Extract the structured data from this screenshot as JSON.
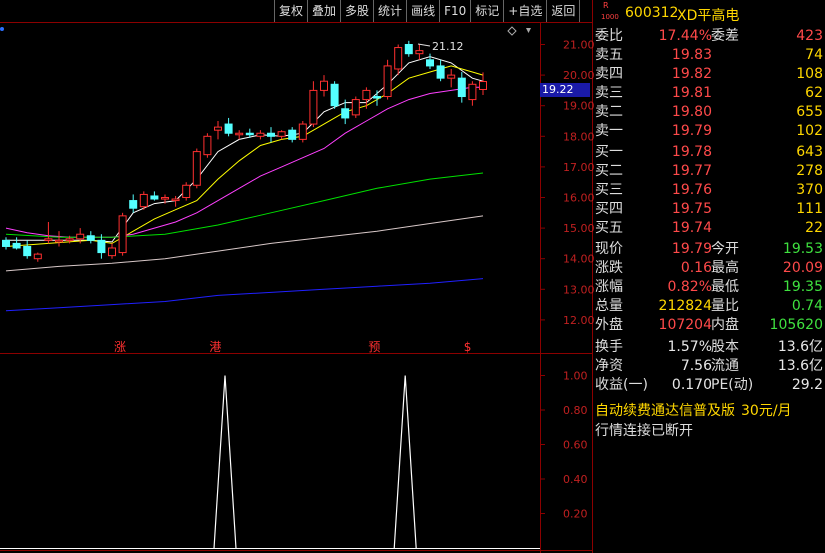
{
  "toolbar": [
    "复权",
    "叠加",
    "多股",
    "统计",
    "画线",
    "F10",
    "标记",
    "+自选",
    "返回"
  ],
  "stock": {
    "r_mark": "R",
    "lot": "1000",
    "code": "600312",
    "name": "XD平高电"
  },
  "quote_rows": [
    {
      "label": "委比",
      "value": "17.44%",
      "label2": "委差",
      "value2": "423",
      "c1": "red",
      "c2": "red"
    },
    {
      "label": "卖五",
      "value": "19.83",
      "value2": "74",
      "c1": "red",
      "c2": "yel"
    },
    {
      "label": "卖四",
      "value": "19.82",
      "value2": "108",
      "c1": "red",
      "c2": "yel"
    },
    {
      "label": "卖三",
      "value": "19.81",
      "value2": "62",
      "c1": "red",
      "c2": "yel"
    },
    {
      "label": "卖二",
      "value": "19.80",
      "value2": "655",
      "c1": "red",
      "c2": "yel"
    },
    {
      "label": "卖一",
      "value": "19.79",
      "value2": "102",
      "c1": "red",
      "c2": "yel"
    },
    {
      "label": "买一",
      "value": "19.78",
      "value2": "643",
      "c1": "red",
      "c2": "yel"
    },
    {
      "label": "买二",
      "value": "19.77",
      "value2": "278",
      "c1": "red",
      "c2": "yel"
    },
    {
      "label": "买三",
      "value": "19.76",
      "value2": "370",
      "c1": "red",
      "c2": "yel"
    },
    {
      "label": "买四",
      "value": "19.75",
      "value2": "111",
      "c1": "red",
      "c2": "yel"
    },
    {
      "label": "买五",
      "value": "19.74",
      "value2": "22",
      "c1": "red",
      "c2": "yel"
    },
    {
      "label": "现价",
      "value": "19.79",
      "label2": "今开",
      "value2": "19.53",
      "c1": "red",
      "c2": "grn"
    },
    {
      "label": "涨跌",
      "value": "0.16",
      "label2": "最高",
      "value2": "20.09",
      "c1": "red",
      "c2": "red"
    },
    {
      "label": "涨幅",
      "value": "0.82%",
      "label2": "最低",
      "value2": "19.35",
      "c1": "red",
      "c2": "grn"
    },
    {
      "label": "总量",
      "value": "212824",
      "label2": "量比",
      "value2": "0.74",
      "c1": "yel",
      "c2": "grn"
    },
    {
      "label": "外盘",
      "value": "107204",
      "label2": "内盘",
      "value2": "105620",
      "c1": "red",
      "c2": "grn"
    },
    {
      "label": "换手",
      "value": "1.57%",
      "label2": "股本",
      "value2": "13.6亿",
      "c1": "wht",
      "c2": "wht"
    },
    {
      "label": "净资",
      "value": "7.56",
      "label2": "流通",
      "value2": "13.6亿",
      "c1": "wht",
      "c2": "wht"
    },
    {
      "label": "收益(一)",
      "value": "0.170",
      "label2": "PE(动)",
      "value2": "29.2",
      "c1": "wht",
      "c2": "wht"
    }
  ],
  "promo": {
    "text": "自动续费通达信普及版",
    "price": "30元/月"
  },
  "connection_status": "行情连接已断开",
  "chart_data": [
    {
      "type": "candlestick",
      "ylim": [
        11.6,
        21.9
      ],
      "y_ticks": [
        "21.00",
        "20.00",
        "19.00",
        "18.00",
        "17.00",
        "16.00",
        "15.00",
        "14.00",
        "13.00",
        "12.00"
      ],
      "current_price": "19.22",
      "high_annotation": "21.12",
      "candles": [
        {
          "o": 14.6,
          "h": 14.7,
          "l": 14.3,
          "c": 14.4
        },
        {
          "o": 14.5,
          "h": 14.7,
          "l": 14.3,
          "c": 14.35
        },
        {
          "o": 14.4,
          "h": 14.6,
          "l": 14.0,
          "c": 14.1
        },
        {
          "o": 14.0,
          "h": 14.2,
          "l": 13.9,
          "c": 14.15
        },
        {
          "o": 14.6,
          "h": 15.2,
          "l": 14.5,
          "c": 14.65
        },
        {
          "o": 14.55,
          "h": 14.9,
          "l": 14.4,
          "c": 14.6
        },
        {
          "o": 14.6,
          "h": 14.75,
          "l": 14.5,
          "c": 14.65
        },
        {
          "o": 14.65,
          "h": 15.0,
          "l": 14.5,
          "c": 14.8
        },
        {
          "o": 14.75,
          "h": 14.9,
          "l": 14.5,
          "c": 14.6
        },
        {
          "o": 14.6,
          "h": 14.8,
          "l": 14.0,
          "c": 14.2
        },
        {
          "o": 14.1,
          "h": 14.5,
          "l": 14.0,
          "c": 14.35
        },
        {
          "o": 14.2,
          "h": 15.5,
          "l": 14.1,
          "c": 15.4
        },
        {
          "o": 15.9,
          "h": 16.1,
          "l": 15.5,
          "c": 15.65
        },
        {
          "o": 15.7,
          "h": 16.2,
          "l": 15.6,
          "c": 16.1
        },
        {
          "o": 16.05,
          "h": 16.2,
          "l": 15.9,
          "c": 15.95
        },
        {
          "o": 15.95,
          "h": 16.1,
          "l": 15.8,
          "c": 16.0
        },
        {
          "o": 15.9,
          "h": 16.05,
          "l": 15.7,
          "c": 15.95
        },
        {
          "o": 16.0,
          "h": 16.5,
          "l": 15.9,
          "c": 16.4
        },
        {
          "o": 16.4,
          "h": 17.6,
          "l": 16.3,
          "c": 17.5
        },
        {
          "o": 17.4,
          "h": 18.1,
          "l": 17.3,
          "c": 18.0
        },
        {
          "o": 18.2,
          "h": 18.5,
          "l": 17.9,
          "c": 18.3
        },
        {
          "o": 18.4,
          "h": 18.6,
          "l": 18.0,
          "c": 18.1
        },
        {
          "o": 18.05,
          "h": 18.2,
          "l": 17.9,
          "c": 18.1
        },
        {
          "o": 18.1,
          "h": 18.25,
          "l": 17.95,
          "c": 18.05
        },
        {
          "o": 18.0,
          "h": 18.2,
          "l": 17.9,
          "c": 18.1
        },
        {
          "o": 18.1,
          "h": 18.3,
          "l": 17.8,
          "c": 18.0
        },
        {
          "o": 18.0,
          "h": 18.2,
          "l": 17.9,
          "c": 18.15
        },
        {
          "o": 18.2,
          "h": 18.3,
          "l": 17.8,
          "c": 17.9
        },
        {
          "o": 17.9,
          "h": 18.5,
          "l": 17.8,
          "c": 18.4
        },
        {
          "o": 18.4,
          "h": 19.8,
          "l": 18.3,
          "c": 19.5
        },
        {
          "o": 19.5,
          "h": 20.0,
          "l": 19.3,
          "c": 19.8
        },
        {
          "o": 19.7,
          "h": 19.8,
          "l": 18.9,
          "c": 19.0
        },
        {
          "o": 18.9,
          "h": 19.2,
          "l": 18.4,
          "c": 18.6
        },
        {
          "o": 18.7,
          "h": 19.3,
          "l": 18.6,
          "c": 19.2
        },
        {
          "o": 19.2,
          "h": 19.6,
          "l": 18.9,
          "c": 19.5
        },
        {
          "o": 19.3,
          "h": 19.5,
          "l": 19.0,
          "c": 19.25
        },
        {
          "o": 19.3,
          "h": 20.5,
          "l": 19.2,
          "c": 20.3
        },
        {
          "o": 20.2,
          "h": 21.0,
          "l": 20.0,
          "c": 20.9
        },
        {
          "o": 21.0,
          "h": 21.12,
          "l": 20.6,
          "c": 20.7
        },
        {
          "o": 20.7,
          "h": 21.0,
          "l": 20.5,
          "c": 20.8
        },
        {
          "o": 20.5,
          "h": 20.7,
          "l": 20.2,
          "c": 20.3
        },
        {
          "o": 20.3,
          "h": 20.5,
          "l": 19.8,
          "c": 19.9
        },
        {
          "o": 19.9,
          "h": 20.2,
          "l": 19.6,
          "c": 20.0
        },
        {
          "o": 19.9,
          "h": 20.1,
          "l": 19.1,
          "c": 19.3
        },
        {
          "o": 19.2,
          "h": 19.8,
          "l": 19.0,
          "c": 19.7
        },
        {
          "o": 19.53,
          "h": 20.09,
          "l": 19.35,
          "c": 19.79
        }
      ],
      "moving_averages": [
        {
          "color": "#ffffff",
          "points": [
            [
              0,
              14.6
            ],
            [
              4,
              14.6
            ],
            [
              8,
              14.6
            ],
            [
              10,
              14.55
            ],
            [
              12,
              15.5
            ],
            [
              14,
              15.8
            ],
            [
              16,
              15.9
            ],
            [
              18,
              16.6
            ],
            [
              20,
              17.5
            ],
            [
              22,
              17.9
            ],
            [
              24,
              18.05
            ],
            [
              26,
              18.0
            ],
            [
              28,
              18.1
            ],
            [
              30,
              18.8
            ],
            [
              32,
              19.1
            ],
            [
              34,
              19.1
            ],
            [
              36,
              19.7
            ],
            [
              38,
              20.4
            ],
            [
              40,
              20.6
            ],
            [
              42,
              20.4
            ],
            [
              44,
              19.9
            ],
            [
              45,
              19.8
            ]
          ]
        },
        {
          "color": "#ffff00",
          "points": [
            [
              0,
              14.4
            ],
            [
              4,
              14.5
            ],
            [
              8,
              14.6
            ],
            [
              10,
              14.5
            ],
            [
              12,
              14.9
            ],
            [
              14,
              15.3
            ],
            [
              16,
              15.6
            ],
            [
              18,
              15.9
            ],
            [
              20,
              16.6
            ],
            [
              22,
              17.2
            ],
            [
              24,
              17.7
            ],
            [
              26,
              17.9
            ],
            [
              28,
              18.0
            ],
            [
              30,
              18.4
            ],
            [
              32,
              18.8
            ],
            [
              34,
              19.0
            ],
            [
              36,
              19.4
            ],
            [
              38,
              19.9
            ],
            [
              40,
              20.1
            ],
            [
              42,
              20.3
            ],
            [
              44,
              20.1
            ],
            [
              45,
              20.0
            ]
          ]
        },
        {
          "color": "#ff40ff",
          "points": [
            [
              0,
              15.0
            ],
            [
              2,
              14.85
            ],
            [
              4,
              14.75
            ],
            [
              6,
              14.7
            ],
            [
              8,
              14.7
            ],
            [
              10,
              14.7
            ],
            [
              12,
              14.8
            ],
            [
              14,
              15.0
            ],
            [
              16,
              15.2
            ],
            [
              18,
              15.5
            ],
            [
              20,
              15.9
            ],
            [
              22,
              16.3
            ],
            [
              24,
              16.7
            ],
            [
              26,
              17.0
            ],
            [
              28,
              17.3
            ],
            [
              30,
              17.6
            ],
            [
              32,
              18.1
            ],
            [
              34,
              18.5
            ],
            [
              36,
              18.9
            ],
            [
              38,
              19.2
            ],
            [
              40,
              19.4
            ],
            [
              42,
              19.5
            ],
            [
              44,
              19.6
            ],
            [
              45,
              19.6
            ]
          ]
        },
        {
          "color": "#00e000",
          "points": [
            [
              0,
              14.8
            ],
            [
              5,
              14.7
            ],
            [
              10,
              14.7
            ],
            [
              15,
              14.8
            ],
            [
              20,
              15.1
            ],
            [
              25,
              15.5
            ],
            [
              30,
              15.9
            ],
            [
              35,
              16.3
            ],
            [
              40,
              16.6
            ],
            [
              45,
              16.8
            ]
          ]
        },
        {
          "color": "#d8c8c8",
          "points": [
            [
              0,
              13.6
            ],
            [
              5,
              13.75
            ],
            [
              10,
              13.85
            ],
            [
              15,
              14.0
            ],
            [
              20,
              14.25
            ],
            [
              25,
              14.5
            ],
            [
              30,
              14.7
            ],
            [
              35,
              14.9
            ],
            [
              40,
              15.15
            ],
            [
              45,
              15.4
            ]
          ]
        },
        {
          "color": "#2020ff",
          "points": [
            [
              0,
              12.3
            ],
            [
              5,
              12.4
            ],
            [
              10,
              12.5
            ],
            [
              15,
              12.6
            ],
            [
              20,
              12.8
            ],
            [
              25,
              12.9
            ],
            [
              30,
              13.0
            ],
            [
              35,
              13.1
            ],
            [
              40,
              13.2
            ],
            [
              45,
              13.35
            ]
          ]
        }
      ]
    },
    {
      "type": "line",
      "ylim": [
        0,
        1.1
      ],
      "y_ticks": [
        "1.00",
        "0.80",
        "0.60",
        "0.40",
        "0.20"
      ],
      "values": [
        0,
        0,
        0,
        0,
        0,
        0,
        0,
        0,
        0,
        0,
        0,
        0,
        0,
        0,
        0,
        0,
        0,
        0,
        0,
        0,
        1,
        0,
        0,
        0,
        0,
        0,
        0,
        0,
        0,
        0,
        0,
        0,
        0,
        0,
        0,
        0,
        0,
        0,
        0,
        0,
        0,
        0,
        0,
        0,
        0,
        0
      ]
    }
  ],
  "chart_markers": [
    {
      "idx": 10,
      "text": "涨"
    },
    {
      "idx": 19,
      "text": "港"
    },
    {
      "idx": 34,
      "text": "预"
    },
    {
      "idx": 43,
      "text": "$"
    }
  ]
}
